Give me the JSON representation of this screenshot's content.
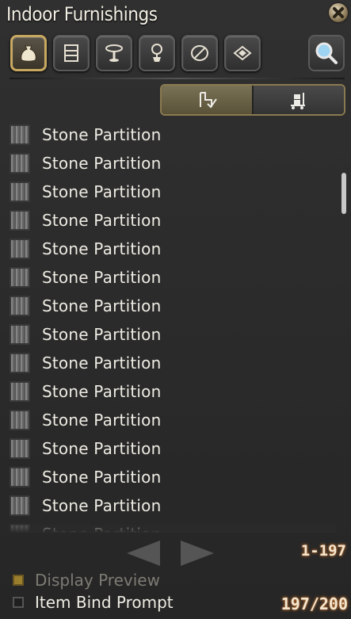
{
  "window": {
    "title": "Indoor Furnishings"
  },
  "categories": [
    {
      "icon": "sack-icon",
      "active": true
    },
    {
      "icon": "cabinet-icon",
      "active": false
    },
    {
      "icon": "table-icon",
      "active": false
    },
    {
      "icon": "potted-plant-icon",
      "active": false
    },
    {
      "icon": "wall-decor-icon",
      "active": false
    },
    {
      "icon": "rug-icon",
      "active": false
    }
  ],
  "search": {
    "icon": "magnifier-icon"
  },
  "view_toggle": [
    {
      "icon": "placed-furniture-icon",
      "active": true
    },
    {
      "icon": "storeroom-cart-icon",
      "active": false
    }
  ],
  "items": [
    {
      "label": "Stone Partition"
    },
    {
      "label": "Stone Partition"
    },
    {
      "label": "Stone Partition"
    },
    {
      "label": "Stone Partition"
    },
    {
      "label": "Stone Partition"
    },
    {
      "label": "Stone Partition"
    },
    {
      "label": "Stone Partition"
    },
    {
      "label": "Stone Partition"
    },
    {
      "label": "Stone Partition"
    },
    {
      "label": "Stone Partition"
    },
    {
      "label": "Stone Partition"
    },
    {
      "label": "Stone Partition"
    },
    {
      "label": "Stone Partition"
    },
    {
      "label": "Stone Partition"
    },
    {
      "label": "Stone Partition"
    }
  ],
  "pager": {
    "range": "1-197"
  },
  "options": {
    "display_preview": {
      "label": "Display Preview",
      "checked": true,
      "enabled": false
    },
    "item_bind_prompt": {
      "label": "Item Bind Prompt",
      "checked": false,
      "enabled": true
    }
  },
  "count": "197/200",
  "colors": {
    "accent_gold": "#c8a860",
    "counter_glow": "#b86a2a"
  }
}
